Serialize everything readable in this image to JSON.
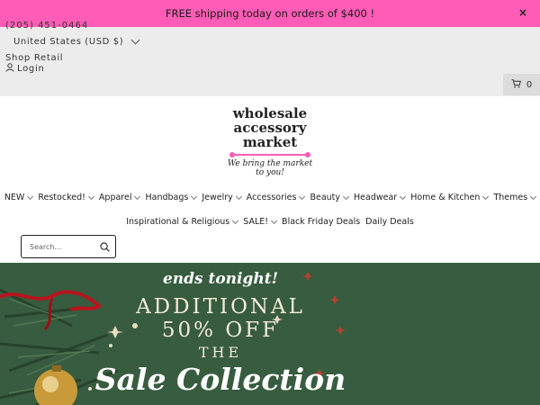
{
  "promo": {
    "text": "FREE shipping today on orders of $400 !",
    "close": "×"
  },
  "utility": {
    "phone": "(205) 451-0464",
    "currency": "United States (USD $)",
    "shop_retail": "Shop Retail",
    "login": "Login"
  },
  "cart": {
    "count": "0"
  },
  "logo": {
    "line1": "wholesale",
    "line2": "accessory",
    "line3": "market",
    "tagline": "We bring the market to you!"
  },
  "nav": {
    "row1": [
      {
        "label": "NEW",
        "dropdown": true
      },
      {
        "label": "Restocked!",
        "dropdown": true
      },
      {
        "label": "Apparel",
        "dropdown": true
      },
      {
        "label": "Handbags",
        "dropdown": true
      },
      {
        "label": "Jewelry",
        "dropdown": true
      },
      {
        "label": "Accessories",
        "dropdown": true
      },
      {
        "label": "Beauty",
        "dropdown": true
      },
      {
        "label": "Headwear",
        "dropdown": true
      },
      {
        "label": "Home & Kitchen",
        "dropdown": true
      },
      {
        "label": "Themes",
        "dropdown": true
      }
    ],
    "row2": [
      {
        "label": "Inspirational & Religious",
        "dropdown": true
      },
      {
        "label": "SALE!",
        "dropdown": true
      },
      {
        "label": "Black Friday Deals",
        "dropdown": false
      },
      {
        "label": "Daily Deals",
        "dropdown": false
      }
    ]
  },
  "search": {
    "placeholder": "Search..."
  },
  "banner": {
    "line1": "ends tonight!",
    "line2": "ADDITIONAL",
    "line3": "50% OFF",
    "line4": "THE",
    "line5": "Sale Collection"
  },
  "colors": {
    "promo_bg": "#fe5cb6",
    "utility_bg": "#ececec",
    "banner_bg": "#385c40"
  }
}
